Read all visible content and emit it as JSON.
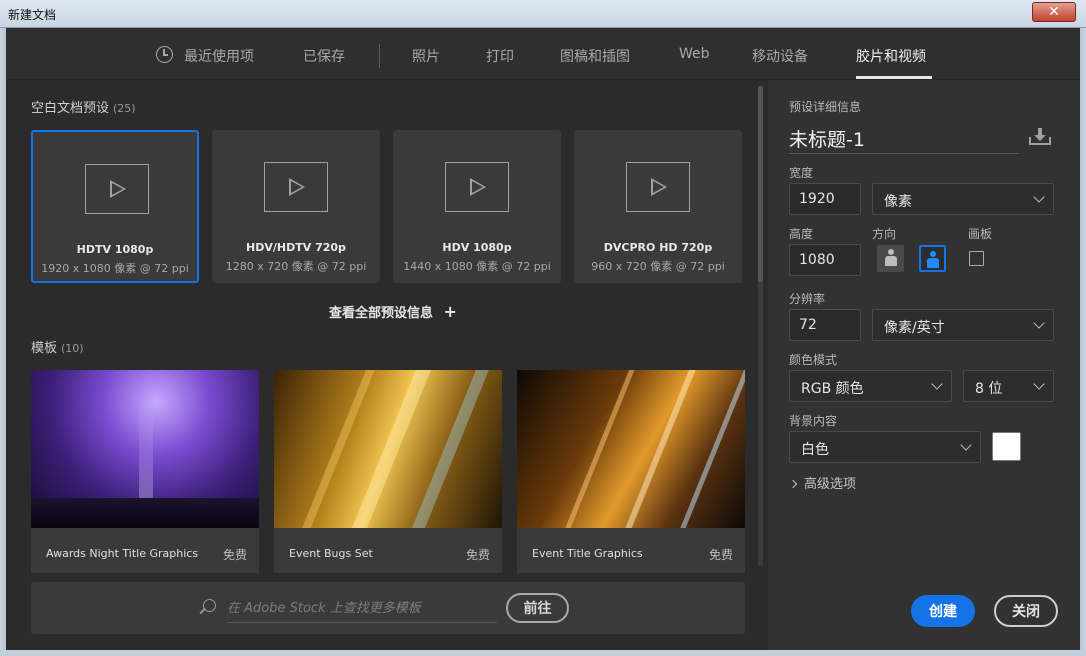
{
  "window": {
    "title": "新建文档",
    "close_glyph": "✕"
  },
  "tabs": [
    {
      "label": "最近使用项",
      "icon": "clock-icon"
    },
    {
      "label": "已保存"
    },
    {
      "label": "照片"
    },
    {
      "label": "打印"
    },
    {
      "label": "图稿和插图"
    },
    {
      "label": "Web"
    },
    {
      "label": "移动设备"
    },
    {
      "label": "胶片和视频",
      "active": true
    }
  ],
  "presets": {
    "title": "空白文档预设",
    "count": "(25)",
    "items": [
      {
        "name": "HDTV 1080p",
        "dims": "1920 x 1080 像素 @ 72 ppi",
        "selected": true
      },
      {
        "name": "HDV/HDTV 720p",
        "dims": "1280 x 720 像素 @ 72 ppi"
      },
      {
        "name": "HDV 1080p",
        "dims": "1440 x 1080 像素 @ 72 ppi"
      },
      {
        "name": "DVCPRO HD 720p",
        "dims": "960 x 720 像素 @ 72 ppi"
      }
    ],
    "view_all": "查看全部预设信息",
    "view_all_icon": "+"
  },
  "templates": {
    "title": "模板",
    "count": "(10)",
    "items": [
      {
        "name": "Awards Night Title Graphics",
        "price": "免费"
      },
      {
        "name": "Event Bugs Set",
        "price": "免费"
      },
      {
        "name": "Event Title Graphics",
        "price": "免费"
      }
    ]
  },
  "stock": {
    "placeholder": "在 Adobe Stock 上查找更多模板",
    "go_label": "前往"
  },
  "details": {
    "header": "预设详细信息",
    "doc_name": "未标题-1",
    "width_label": "宽度",
    "width_value": "1920",
    "width_unit": "像素",
    "height_label": "高度",
    "height_value": "1080",
    "orientation_label": "方向",
    "artboard_label": "画板",
    "resolution_label": "分辨率",
    "resolution_value": "72",
    "resolution_unit": "像素/英寸",
    "color_mode_label": "颜色模式",
    "color_mode": "RGB 颜色",
    "bit_depth": "8 位",
    "background_label": "背景内容",
    "background": "白色",
    "background_color": "#ffffff",
    "advanced": "高级选项",
    "create_label": "创建",
    "close_label": "关闭"
  },
  "colors": {
    "accent": "#1473e6"
  }
}
